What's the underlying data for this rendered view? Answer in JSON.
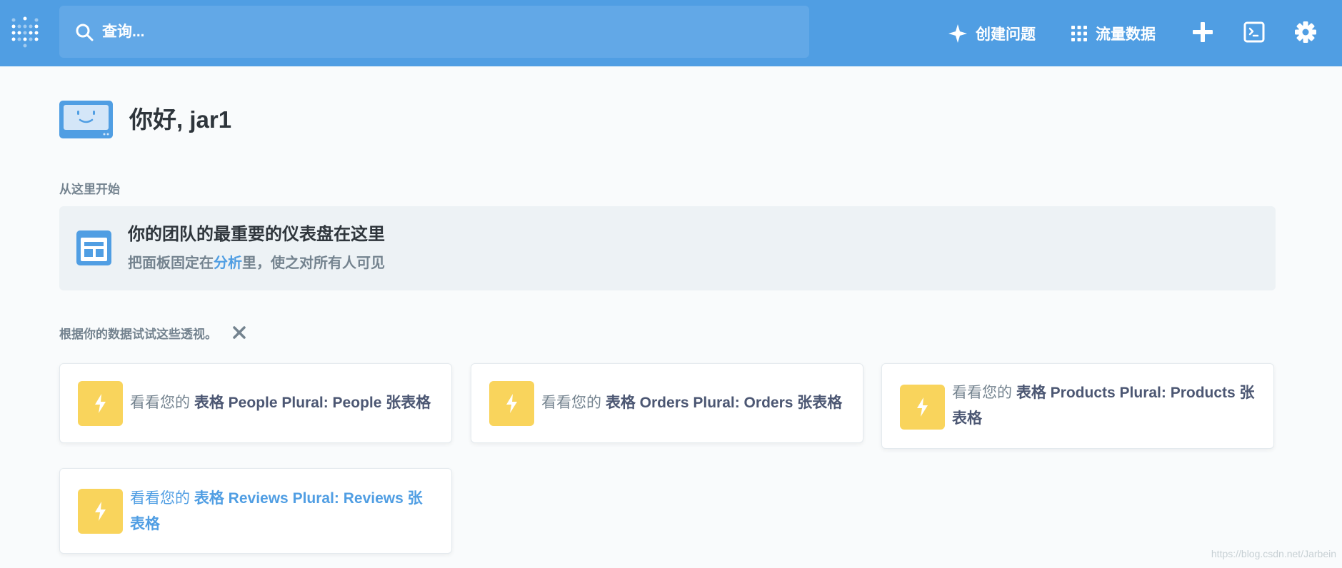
{
  "nav": {
    "search_placeholder": "查询...",
    "create_question": "创建问题",
    "browse_data": "流量数据"
  },
  "greeting": "你好, jar1",
  "start_section": {
    "label": "从这里开始",
    "title": "你的团队的最重要的仪表盘在这里",
    "desc_before": "把面板固定在",
    "desc_link": "分析",
    "desc_after": "里，使之对所有人可见"
  },
  "xray_section": {
    "label": "根据你的数据试试这些透视。"
  },
  "cards": [
    {
      "prefix": "看看您的 ",
      "strong": "表格 People Plural: People 张表格"
    },
    {
      "prefix": "看看您的 ",
      "strong": "表格 Orders Plural: Orders 张表格"
    },
    {
      "prefix": "看看您的 ",
      "strong": "表格 Products Plural: Products 张表格"
    },
    {
      "prefix": "看看您的 ",
      "strong": "表格 Reviews Plural: Reviews 张表格"
    }
  ],
  "watermark": "https://blog.csdn.net/Jarbein",
  "colors": {
    "brand": "#509ee3",
    "search_bg": "#62a8e7",
    "bolt": "#f9d45c",
    "text_dark": "#2e353b",
    "text_muted": "#74838f"
  },
  "icons": [
    "metabase-logo-icon",
    "search-icon",
    "sparkle-icon",
    "grid-icon",
    "plus-icon",
    "terminal-icon",
    "gear-icon",
    "avatar-icon",
    "dashboard-icon",
    "close-icon",
    "bolt-icon"
  ]
}
